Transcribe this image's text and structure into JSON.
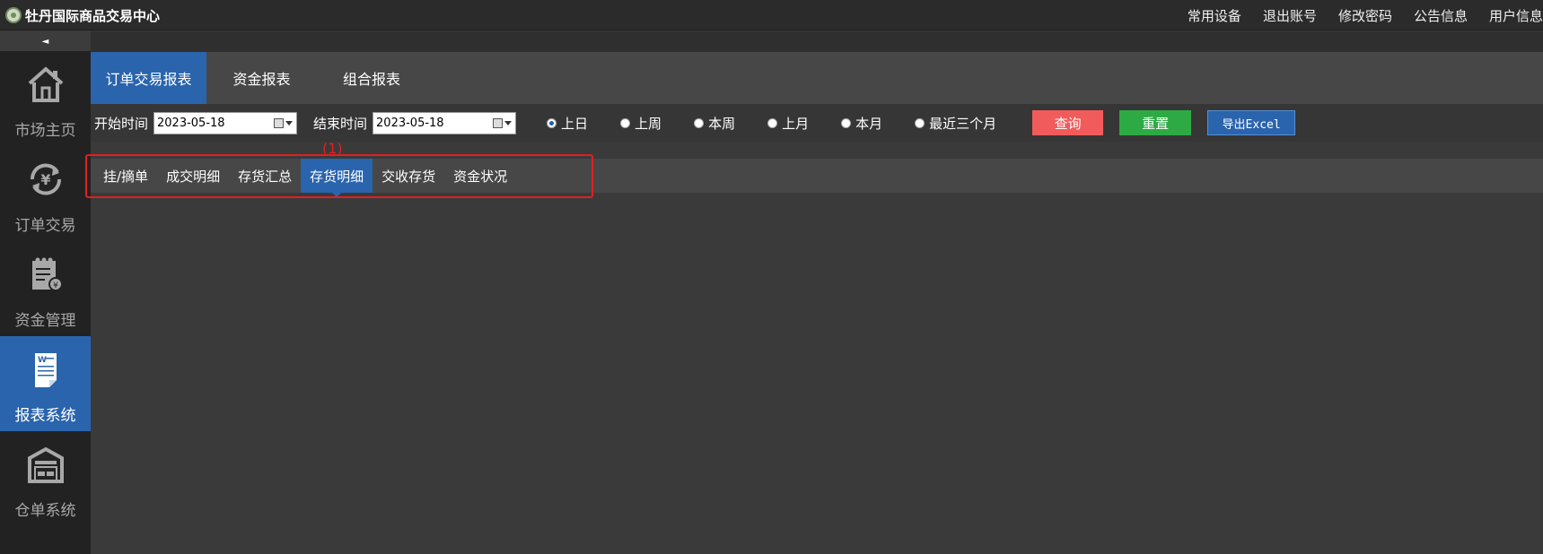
{
  "app": {
    "title": "牡丹国际商品交易中心"
  },
  "top_links": [
    "常用设备",
    "退出账号",
    "修改密码",
    "公告信息",
    "用户信息"
  ],
  "sidebar": {
    "collapse_icon": "◄",
    "items": [
      {
        "label": "市场主页",
        "icon": "home-icon",
        "active": false
      },
      {
        "label": "订单交易",
        "icon": "yuan-exchange-icon",
        "active": false
      },
      {
        "label": "资金管理",
        "icon": "funds-notepad-icon",
        "active": false
      },
      {
        "label": "报表系统",
        "icon": "report-document-icon",
        "active": true
      },
      {
        "label": "仓单系统",
        "icon": "warehouse-icon",
        "active": false
      }
    ]
  },
  "main_tabs": [
    {
      "label": "订单交易报表",
      "active": true
    },
    {
      "label": "资金报表",
      "active": false
    },
    {
      "label": "组合报表",
      "active": false
    }
  ],
  "filters": {
    "start_label": "开始时间",
    "start_value": "2023-05-18",
    "end_label": "结束时间",
    "end_value": "2023-05-18",
    "ranges": [
      {
        "label": "上日",
        "checked": true
      },
      {
        "label": "上周",
        "checked": false
      },
      {
        "label": "本周",
        "checked": false
      },
      {
        "label": "上月",
        "checked": false
      },
      {
        "label": "本月",
        "checked": false
      },
      {
        "label": "最近三个月",
        "checked": false
      }
    ],
    "query_label": "查询",
    "reset_label": "重置",
    "export_label": "导出Excel"
  },
  "sub_tabs": [
    {
      "label": "挂/摘单",
      "active": false
    },
    {
      "label": "成交明细",
      "active": false
    },
    {
      "label": "存货汇总",
      "active": false
    },
    {
      "label": "存货明细",
      "active": true
    },
    {
      "label": "交收存货",
      "active": false
    },
    {
      "label": "资金状况",
      "active": false
    }
  ],
  "annotation": "(1)",
  "colors": {
    "accent": "#2a64ad",
    "query": "#f25b5b",
    "reset": "#2eaa45",
    "highlight": "#e02020"
  }
}
